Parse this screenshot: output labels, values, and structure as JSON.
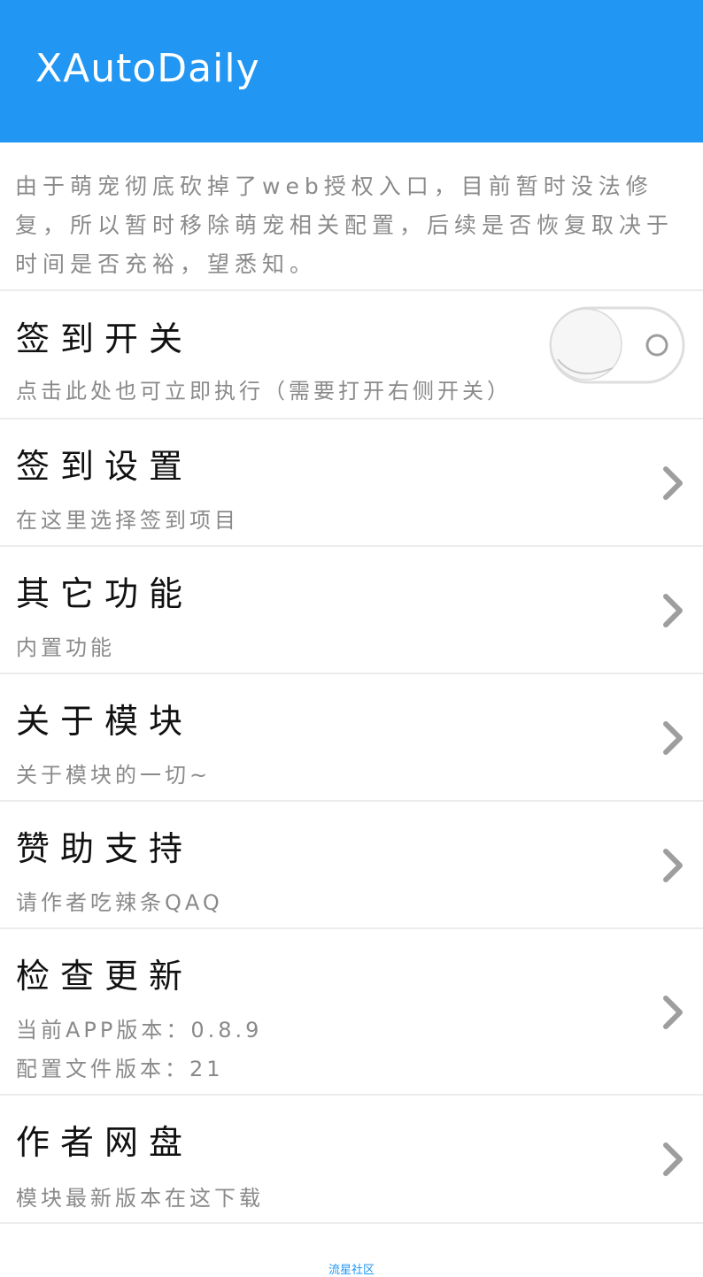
{
  "app": {
    "title": "XAutoDaily"
  },
  "notice": {
    "text": "由于萌宠彻底砍掉了web授权入口，目前暂时没法修复，所以暂时移除萌宠相关配置，后续是否恢复取决于时间是否充裕，望悉知。"
  },
  "rows": [
    {
      "title": "签到开关",
      "subtitle": "点击此处也可立即执行（需要打开右侧开关）",
      "toggle_on": false
    },
    {
      "title": "签到设置",
      "subtitle": "在这里选择签到项目"
    },
    {
      "title": "其它功能",
      "subtitle": "内置功能"
    },
    {
      "title": "关于模块",
      "subtitle": "关于模块的一切~"
    },
    {
      "title": "赞助支持",
      "subtitle": "请作者吃辣条QAQ"
    },
    {
      "title": "检查更新",
      "subtitle": "当前APP版本：0.8.9",
      "subtitle2": "配置文件版本：21"
    },
    {
      "title": "作者网盘",
      "subtitle": "模块最新版本在这下载"
    }
  ],
  "footer": {
    "text": "流星社区"
  },
  "colors": {
    "accent": "#2196f3",
    "divider": "#ececec",
    "secondary_text": "#8a8a8a"
  },
  "icons": {
    "chevron": "chevron-right-icon"
  }
}
